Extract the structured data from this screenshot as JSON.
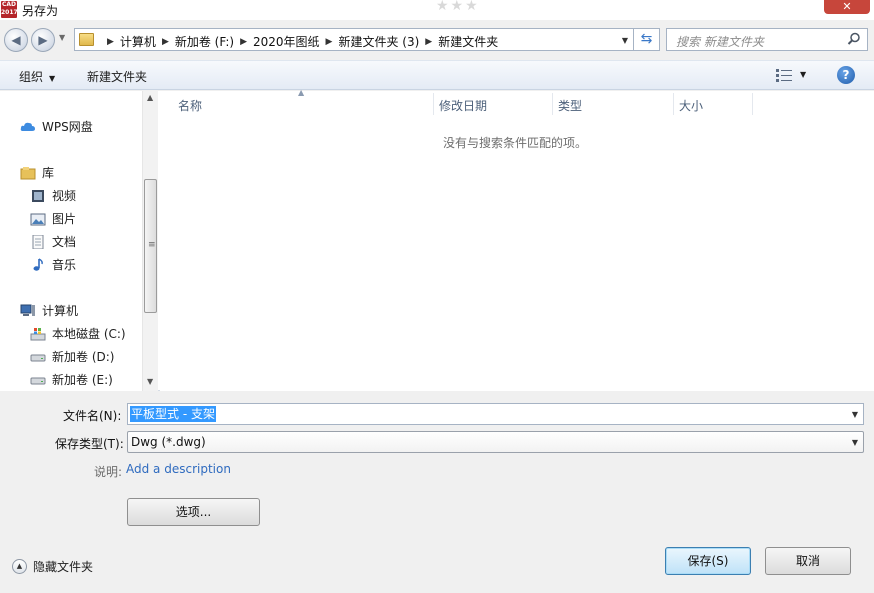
{
  "window": {
    "title": "另存为",
    "app_icon_text": "CAD 2017",
    "close_glyph": "✕",
    "watermark": "★★★"
  },
  "address": {
    "crumbs": [
      "计算机",
      "新加卷 (F:)",
      "2020年图纸",
      "新建文件夹 (3)",
      "新建文件夹"
    ],
    "search_placeholder": "搜索 新建文件夹"
  },
  "toolbar": {
    "organize_label": "组织",
    "new_folder_label": "新建文件夹"
  },
  "nav": {
    "items": [
      {
        "label": "WPS网盘",
        "icon": "cloud-icon"
      },
      {
        "label": "库",
        "icon": "library-icon"
      },
      {
        "label": "视频",
        "icon": "video-icon"
      },
      {
        "label": "图片",
        "icon": "picture-icon"
      },
      {
        "label": "文档",
        "icon": "document-icon"
      },
      {
        "label": "音乐",
        "icon": "music-icon"
      },
      {
        "label": "计算机",
        "icon": "computer-icon"
      },
      {
        "label": "本地磁盘 (C:)",
        "icon": "system-drive-icon"
      },
      {
        "label": "新加卷 (D:)",
        "icon": "drive-icon"
      },
      {
        "label": "新加卷 (E:)",
        "icon": "drive-icon"
      }
    ]
  },
  "files": {
    "columns": [
      "名称",
      "修改日期",
      "类型",
      "大小"
    ],
    "empty_message": "没有与搜索条件匹配的项。"
  },
  "form": {
    "filename_label": "文件名(N):",
    "filename_value": "平板型式 - 支架",
    "filetype_label": "保存类型(T):",
    "filetype_value": "Dwg (*.dwg)",
    "description_label": "说明:",
    "description_link": "Add a description",
    "options_button": "选项...",
    "save_button": "保存(S)",
    "cancel_button": "取消",
    "hide_folders_label": "隐藏文件夹"
  },
  "colors": {
    "selection": "#3399ff",
    "link": "#2f6bbf",
    "close_button": "#c7463b"
  }
}
